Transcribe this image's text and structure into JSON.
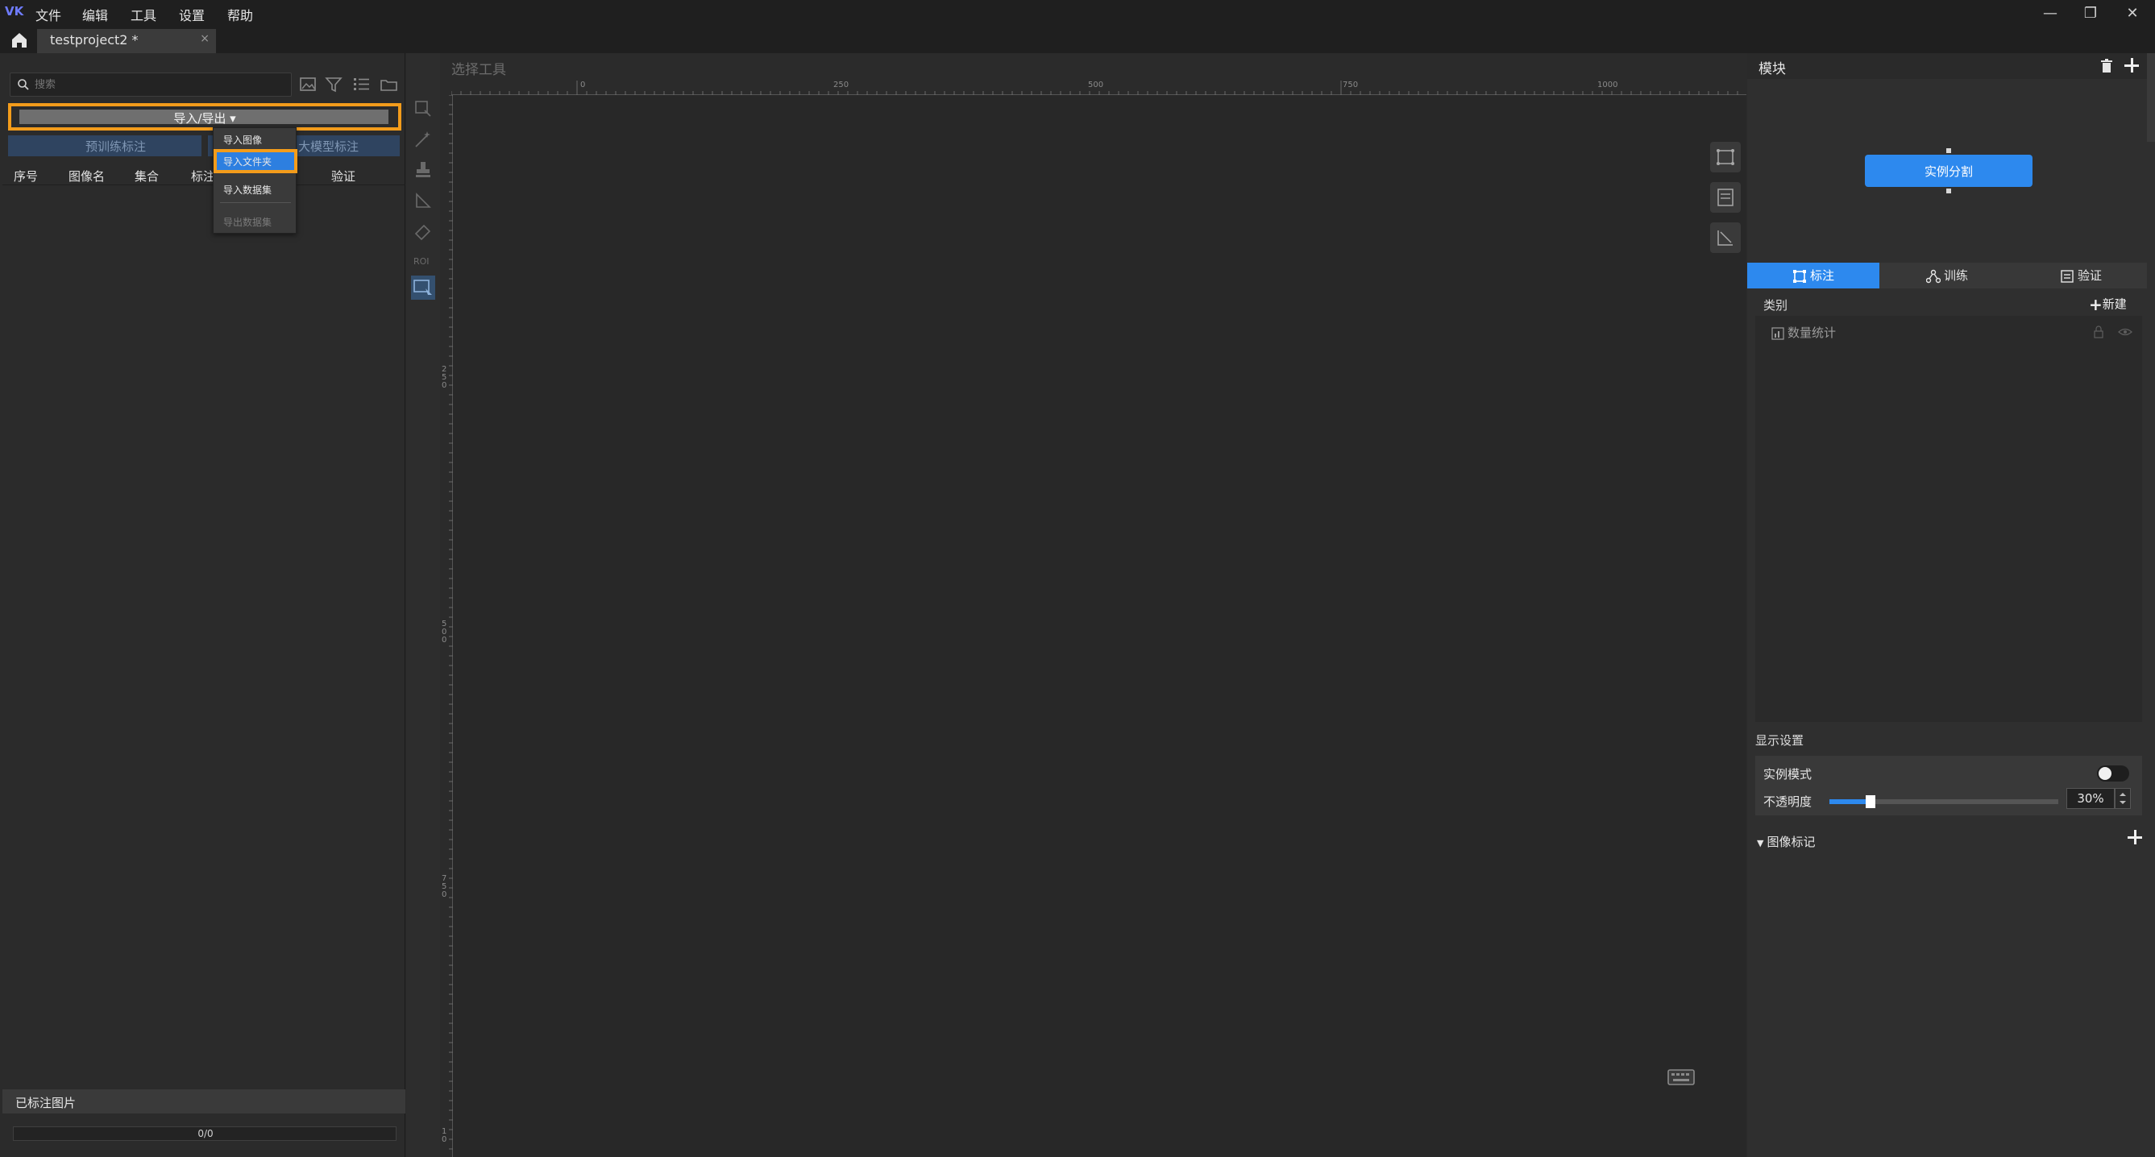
{
  "app": {
    "logo": "VK"
  },
  "menu": [
    "文件",
    "编辑",
    "工具",
    "设置",
    "帮助"
  ],
  "window_controls": {
    "minimize": "—",
    "restore": "❐",
    "close": "✕"
  },
  "tab": {
    "title": "testproject2 *",
    "close": "×"
  },
  "left": {
    "search_placeholder": "搜索",
    "import_export": "导入/导出 ▾",
    "pretrain_label": "预训练标注",
    "llm_label": "大模型标注",
    "columns": [
      "序号",
      "图像名",
      "集合",
      "标注",
      "验证"
    ],
    "labeled_title": "已标注图片",
    "progress_text": "0/0",
    "progress_fraction": 0
  },
  "dropdown": {
    "items": [
      "导入图像",
      "导入文件夹",
      "导入数据集",
      "导出数据集"
    ]
  },
  "canvas": {
    "title": "选择工具",
    "h_ruler_labels": [
      "0",
      "250",
      "500",
      "750",
      "1000"
    ],
    "v_ruler_labels": [
      "2\n5\n0",
      "5\n0\n0",
      "7\n5\n0",
      "1\n0"
    ]
  },
  "right": {
    "module_title": "模块",
    "module_node": "实例分割",
    "tabs": [
      "标注",
      "训练",
      "验证"
    ],
    "category_label": "类别",
    "new_label": "新建",
    "stat_label": "数量统计",
    "display_settings": "显示设置",
    "instance_mode_label": "实例模式",
    "instance_mode_on": false,
    "opacity_label": "不透明度",
    "opacity_value": "30%",
    "opacity_fraction": 0.18,
    "image_mark_label": "图像标记"
  },
  "colors": {
    "accent": "#2d89ee",
    "highlight": "#f39c1b"
  }
}
